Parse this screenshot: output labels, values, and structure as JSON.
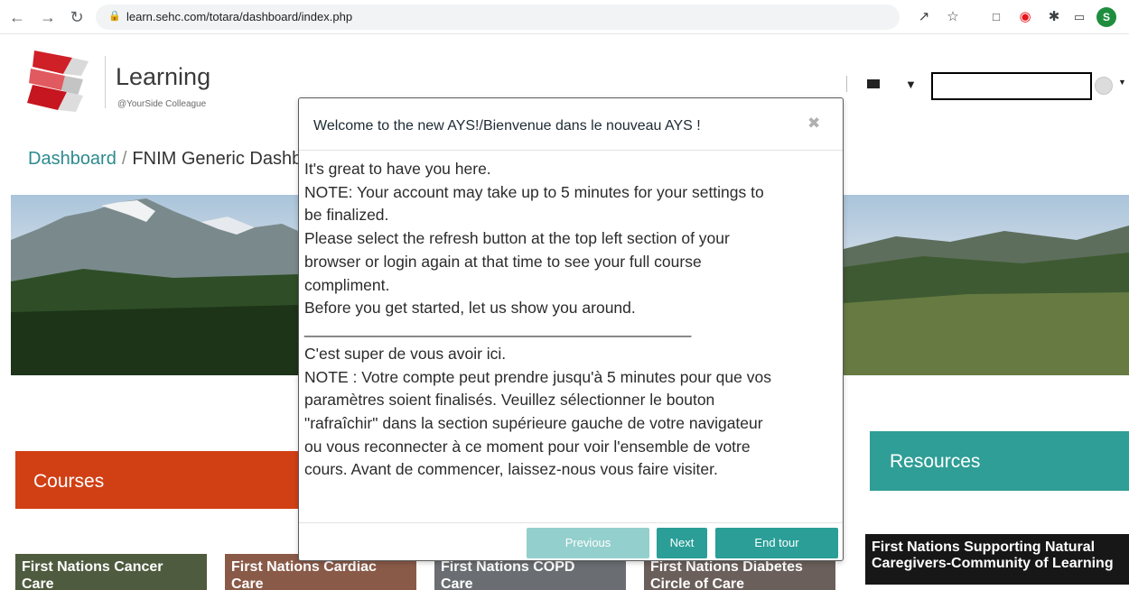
{
  "browser": {
    "url": "learn.sehc.com/totara/dashboard/index.php",
    "profile_initial": "S",
    "nav_icons": [
      "back-arrow-icon",
      "forward-arrow-icon",
      "reload-icon"
    ],
    "toolbar_icons": [
      "share-icon",
      "bookmark-star-icon",
      "screenshot-icon",
      "record-icon",
      "extensions-puzzle-icon",
      "sidepanel-icon"
    ]
  },
  "header": {
    "logo_title": "Learning",
    "logo_subtitle": "@YourSide Colleague",
    "logo_color": "#d2232a"
  },
  "breadcrumb": {
    "home": "Dashboard",
    "separator": "/",
    "current": "FNIM Generic Dashb"
  },
  "tour": {
    "title": "Welcome to the new AYS!/Bienvenue dans le nouveau AYS !",
    "close_glyph": "✖",
    "lines": [
      "It's great to have you here.",
      "NOTE: Your account may take up to 5 minutes for your settings to",
      "be finalized.",
      "Please select the refresh button at the top left section of your",
      "browser or login again at that time to see your full course",
      "compliment.",
      "Before you get started, let us show you around.",
      "____________________________________________",
      "C'est super de vous avoir ici.",
      "NOTE : Votre compte peut prendre jusqu'à 5 minutes pour que vos",
      "paramètres soient finalisés. Veuillez sélectionner le bouton",
      "\"rafraîchir\" dans la section supérieure gauche de votre navigateur",
      "ou vous reconnecter à ce moment pour voir l'ensemble de votre",
      "cours. Avant de commencer, laissez-nous vous faire visiter."
    ],
    "buttons": {
      "previous": "Previous",
      "next": "Next",
      "end": "End tour"
    },
    "accent": "#2a9e97"
  },
  "courses": {
    "title": "Courses",
    "color": "#d13f14",
    "tiles": [
      {
        "label": "First Nations Cancer",
        "label2": "Care"
      },
      {
        "label": "First Nations Cardiac",
        "label2": "Care"
      },
      {
        "label": "First Nations COPD",
        "label2": "Care"
      },
      {
        "label": "First Nations Diabetes",
        "label2": "Circle of Care"
      }
    ]
  },
  "resources": {
    "title": "Resources",
    "color": "#2e9e96",
    "tile_label": "First Nations Supporting Natural Caregivers-Community of Learning"
  }
}
